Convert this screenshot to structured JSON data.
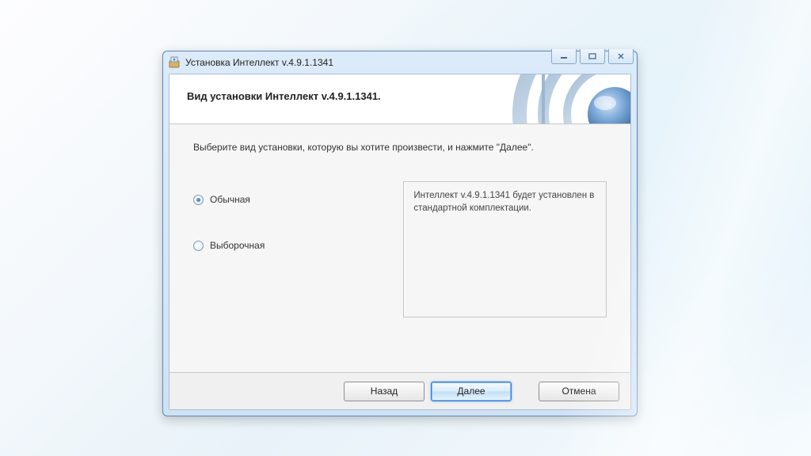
{
  "window": {
    "title": "Установка Интеллект v.4.9.1.1341"
  },
  "banner": {
    "heading": "Вид установки Интеллект v.4.9.1.1341."
  },
  "body": {
    "instruction": "Выберите вид установки, которую вы хотите произвести, и нажмите \"Далее\".",
    "options": {
      "normal": {
        "label": "Обычная",
        "selected": true
      },
      "custom": {
        "label": "Выборочная",
        "selected": false
      }
    },
    "description": "Интеллект v.4.9.1.1341 будет установлен в стандартной комплектации."
  },
  "footer": {
    "back": "Назад",
    "next": "Далее",
    "cancel": "Отмена"
  }
}
